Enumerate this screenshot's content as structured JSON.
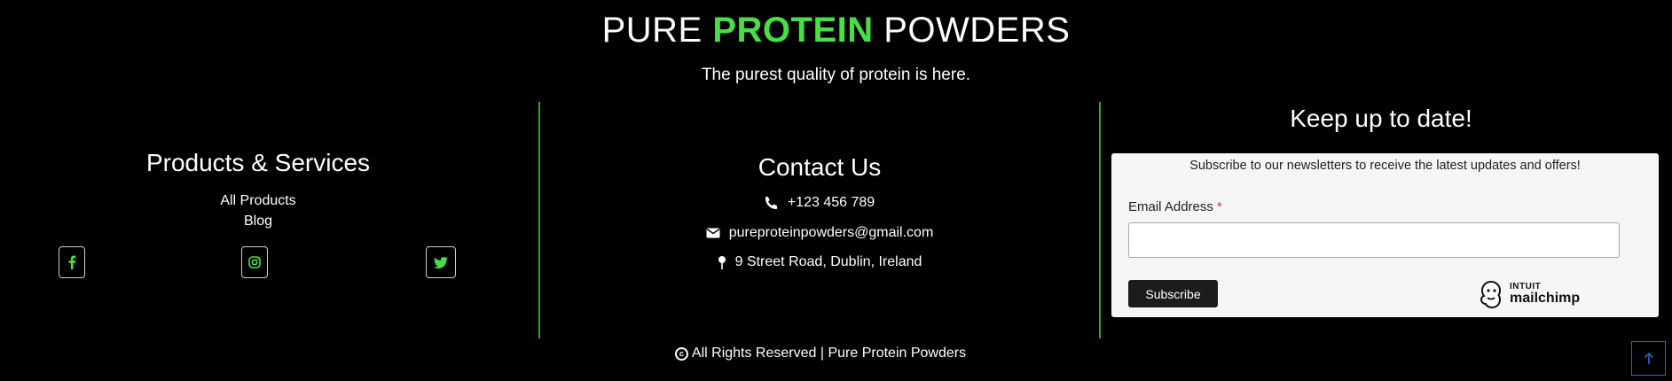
{
  "header": {
    "brand_part1": "PURE ",
    "brand_accent": "PROTEIN",
    "brand_part2": " POWDERS",
    "tagline": "The purest quality of protein is here."
  },
  "products": {
    "title": "Products & Services",
    "links": [
      "All Products",
      "Blog"
    ],
    "socials": [
      "facebook-icon",
      "instagram-icon",
      "twitter-icon"
    ]
  },
  "contact": {
    "title": "Contact Us",
    "phone": "+123 456 789",
    "email": "pureproteinpowders@gmail.com",
    "address": "9 Street Road, Dublin, Ireland"
  },
  "newsletter": {
    "title": "Keep up to date!",
    "description": "Subscribe to our newsletters to receive the latest updates and offers!",
    "email_label": "Email Address",
    "required_mark": "*",
    "email_value": "",
    "button": "Subscribe",
    "mc_intuit": "INTUIT",
    "mc_name": "mailchimp"
  },
  "footer": {
    "copyright": "All Rights Reserved | Pure Protein Powders"
  },
  "colors": {
    "accent": "#46e046",
    "divider": "#2fa82f",
    "background": "#000000"
  }
}
